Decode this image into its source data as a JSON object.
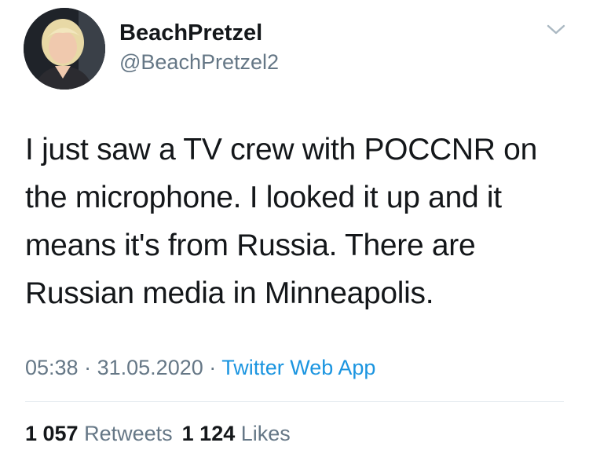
{
  "user": {
    "display_name": "BeachPretzel",
    "handle": "@BeachPretzel2"
  },
  "tweet": {
    "text": "I just saw a TV crew with POCCNR on the microphone. I looked it up and it means it's from Russia. There are Russian media in Minneapolis.",
    "time": "05:38",
    "separator": "·",
    "date": "31.05.2020",
    "source": "Twitter Web App"
  },
  "stats": {
    "retweets_count": "1 057",
    "retweets_label": "Retweets",
    "likes_count": "1 124",
    "likes_label": "Likes"
  },
  "icons": {
    "menu": "chevron-down-icon"
  },
  "colors": {
    "text": "#14171a",
    "secondary": "#657786",
    "link": "#1b95e0",
    "divider": "#e1e8ed"
  }
}
